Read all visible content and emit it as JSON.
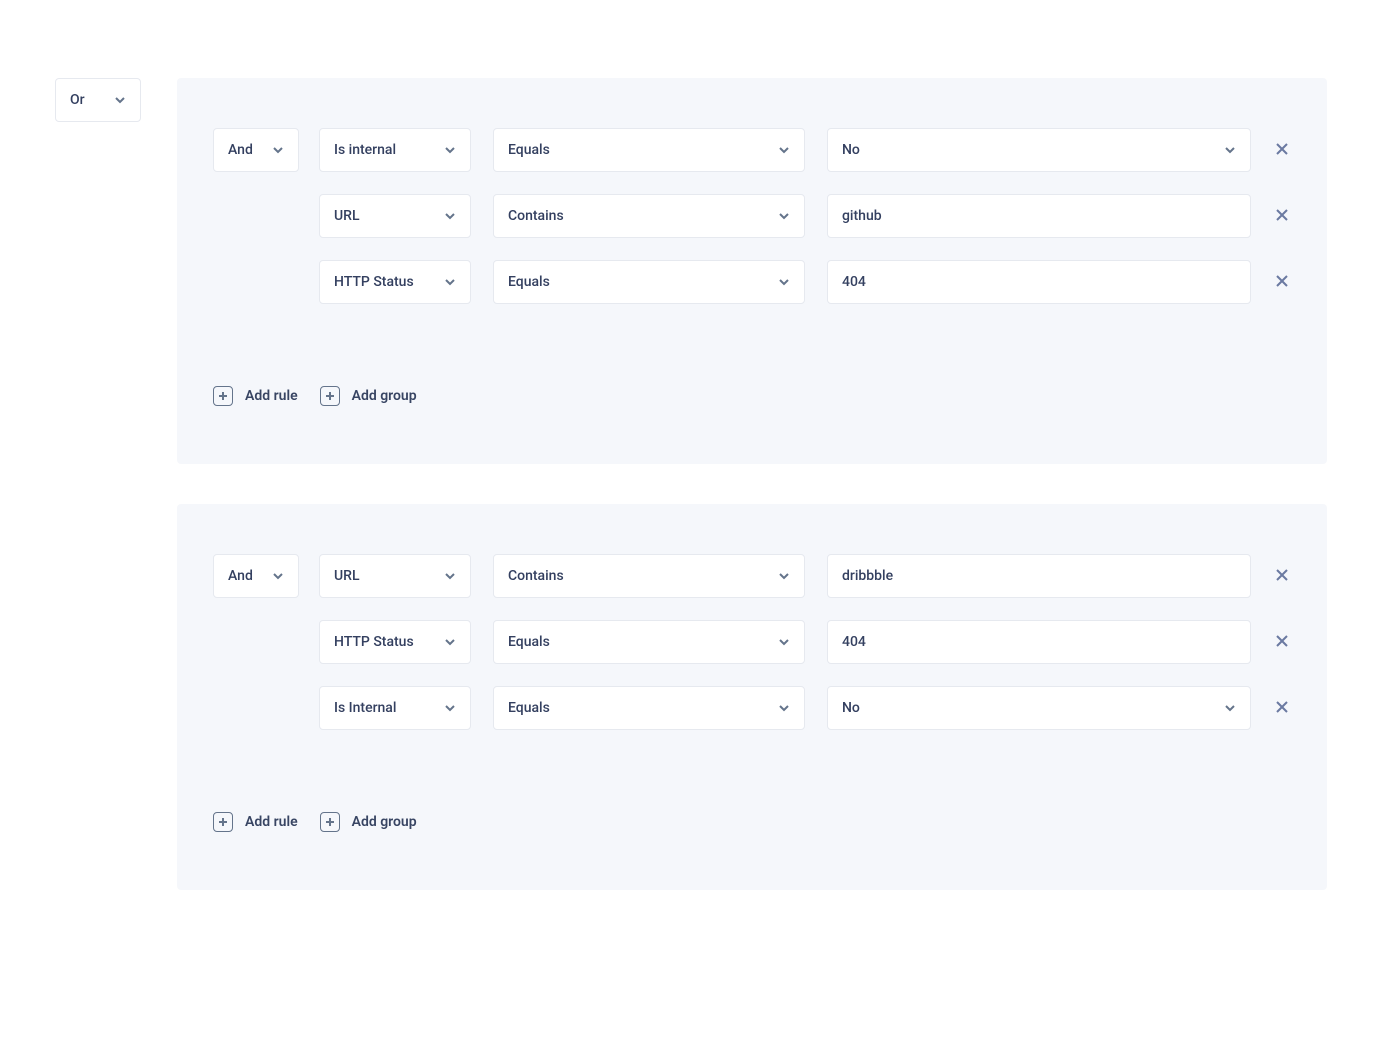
{
  "outer_operator": "Or",
  "add_rule_label": "Add rule",
  "add_group_label": "Add group",
  "groups": [
    {
      "operator": "And",
      "rules": [
        {
          "field": "Is internal",
          "op": "Equals",
          "value": "No",
          "value_is_select": true
        },
        {
          "field": "URL",
          "op": "Contains",
          "value": "github",
          "value_is_select": false
        },
        {
          "field": "HTTP Status",
          "op": "Equals",
          "value": "404",
          "value_is_select": false
        }
      ]
    },
    {
      "operator": "And",
      "rules": [
        {
          "field": "URL",
          "op": "Contains",
          "value": "dribbble",
          "value_is_select": false
        },
        {
          "field": "HTTP Status",
          "op": "Equals",
          "value": "404",
          "value_is_select": false
        },
        {
          "field": "Is Internal",
          "op": "Equals",
          "value": "No",
          "value_is_select": true
        }
      ]
    }
  ]
}
